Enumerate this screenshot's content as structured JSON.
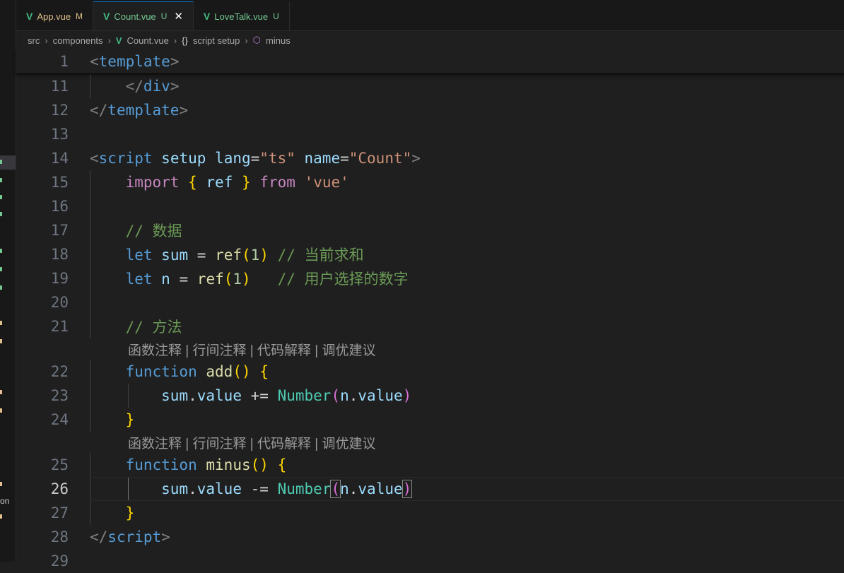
{
  "tabs": [
    {
      "label": "App.vue",
      "status": "M",
      "active": false
    },
    {
      "label": "Count.vue",
      "status": "U",
      "active": true,
      "close": "✕"
    },
    {
      "label": "LoveTalk.vue",
      "status": "U",
      "active": false
    }
  ],
  "breadcrumb": {
    "items": [
      "src",
      "components",
      "Count.vue",
      "script setup",
      "minus"
    ]
  },
  "sidebar_fragment": "on",
  "code": {
    "current_line": "26",
    "lines": [
      {
        "n": "1"
      },
      {
        "n": "11"
      },
      {
        "n": "12"
      },
      {
        "n": "13"
      },
      {
        "n": "14"
      },
      {
        "n": "15"
      },
      {
        "n": "16"
      },
      {
        "n": "17"
      },
      {
        "n": "18"
      },
      {
        "n": "19"
      },
      {
        "n": "20"
      },
      {
        "n": "21"
      },
      {
        "n": "22"
      },
      {
        "n": "23"
      },
      {
        "n": "24"
      },
      {
        "n": "25"
      },
      {
        "n": "26"
      },
      {
        "n": "27"
      },
      {
        "n": "28"
      },
      {
        "n": "29"
      }
    ],
    "tokens": {
      "lt": "<",
      "gt": ">",
      "lt_slash": "</",
      "template": "template",
      "div": "div",
      "script": "script",
      "setup": "setup",
      "lang": "lang",
      "name": "name",
      "eq": "=",
      "ts_str": "\"ts\"",
      "count_str": "\"Count\"",
      "import": "import",
      "lbrace": "{",
      "rbrace": "}",
      "ref": "ref",
      "from": "from",
      "vue_str": "'vue'",
      "comment_data": "// 数据",
      "let": "let",
      "sum": "sum",
      "n": "n",
      "one": "1",
      "lparen": "(",
      "rparen": ")",
      "empty_parens": "()",
      "comment_sum": "// 当前求和",
      "comment_n": "// 用户选择的数字",
      "comment_methods": "// 方法",
      "function": "function",
      "add": "add",
      "minus": "minus",
      "sum_value": "sum",
      "dot": ".",
      "value": "value",
      "plus_eq": "+=",
      "minus_eq": "-=",
      "Number": "Number"
    },
    "codelens": "函数注释 | 行间注释 | 代码解释 | 调优建议"
  }
}
